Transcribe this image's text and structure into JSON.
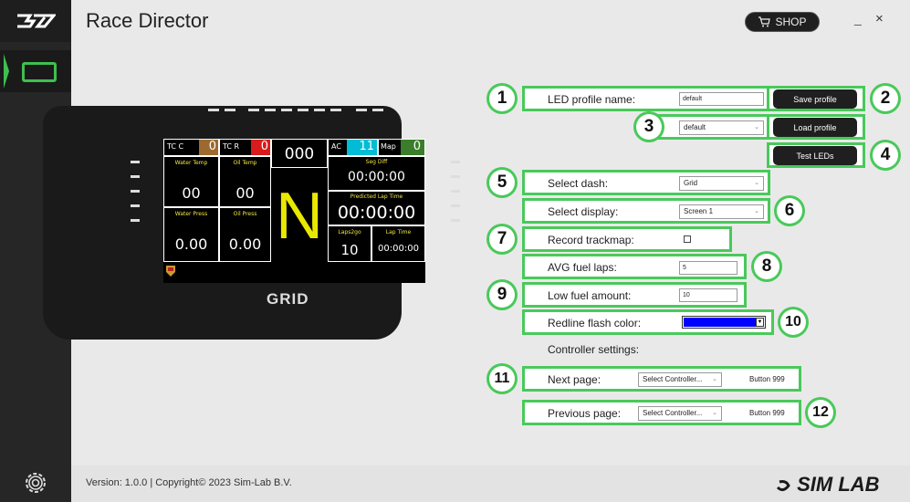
{
  "header": {
    "title": "Race Director",
    "shop_label": "SHOP",
    "minimize": "_",
    "close": "×"
  },
  "footer": {
    "version": "Version: 1.0.0 | Copyright© 2023 Sim-Lab B.V.",
    "brand": "SIM LAB"
  },
  "dash_screen": {
    "tc_c_label": "TC C",
    "tc_c_value": "0",
    "tc_r_label": "TC R",
    "tc_r_value": "0",
    "speed": "000",
    "ac_label": "AC",
    "ac_value": "11",
    "map_label": "Map",
    "map_value": "0",
    "water_temp_label": "Water Temp",
    "water_temp_value": "00",
    "oil_temp_label": "Oil Temp",
    "oil_temp_value": "00",
    "seg_diff_label": "Seg Diff",
    "seg_diff_value": "00:00:00",
    "gear": "N",
    "predicted_lap_label": "Predicted Lap Time",
    "predicted_lap_value": "00:00:00",
    "water_press_label": "Water Press",
    "water_press_value": "0.00",
    "oil_press_label": "Oil Press",
    "oil_press_value": "0.00",
    "laps2go_label": "Laps2go",
    "laps2go_value": "10",
    "lap_time_label": "Lap Time",
    "lap_time_value": "00:00:00",
    "device_logo": "GRID"
  },
  "settings": {
    "led_profile_label": "LED profile name:",
    "led_profile_value": "default",
    "save_profile": "Save profile",
    "profile_select": "default",
    "load_profile": "Load profile",
    "test_leds": "Test LEDs",
    "select_dash_label": "Select dash:",
    "select_dash_value": "Grid",
    "select_display_label": "Select display:",
    "select_display_value": "Screen 1",
    "record_trackmap_label": "Record trackmap:",
    "avg_fuel_laps_label": "AVG fuel laps:",
    "avg_fuel_laps_value": "5",
    "low_fuel_label": "Low fuel amount:",
    "low_fuel_value": "10",
    "redline_label": "Redline flash color:",
    "redline_color": "#0000ff",
    "controller_settings": "Controller settings:",
    "next_page_label": "Next page:",
    "next_page_controller": "Select Controller...",
    "next_page_button": "Button 999",
    "prev_page_label": "Previous page:",
    "prev_page_controller": "Select Controller...",
    "prev_page_button": "Button 999"
  },
  "callouts": [
    "1",
    "2",
    "3",
    "4",
    "5",
    "6",
    "7",
    "8",
    "9",
    "10",
    "11",
    "12"
  ],
  "colors": {
    "accent": "#49c95a",
    "sidebar": "#262626",
    "ac_cyan": "#00bcd4",
    "tc_c_brown": "#9c6a2e",
    "tc_r_red": "#d81b1b",
    "map_green": "#3a7d2a",
    "gear_yellow": "#e8e800"
  }
}
